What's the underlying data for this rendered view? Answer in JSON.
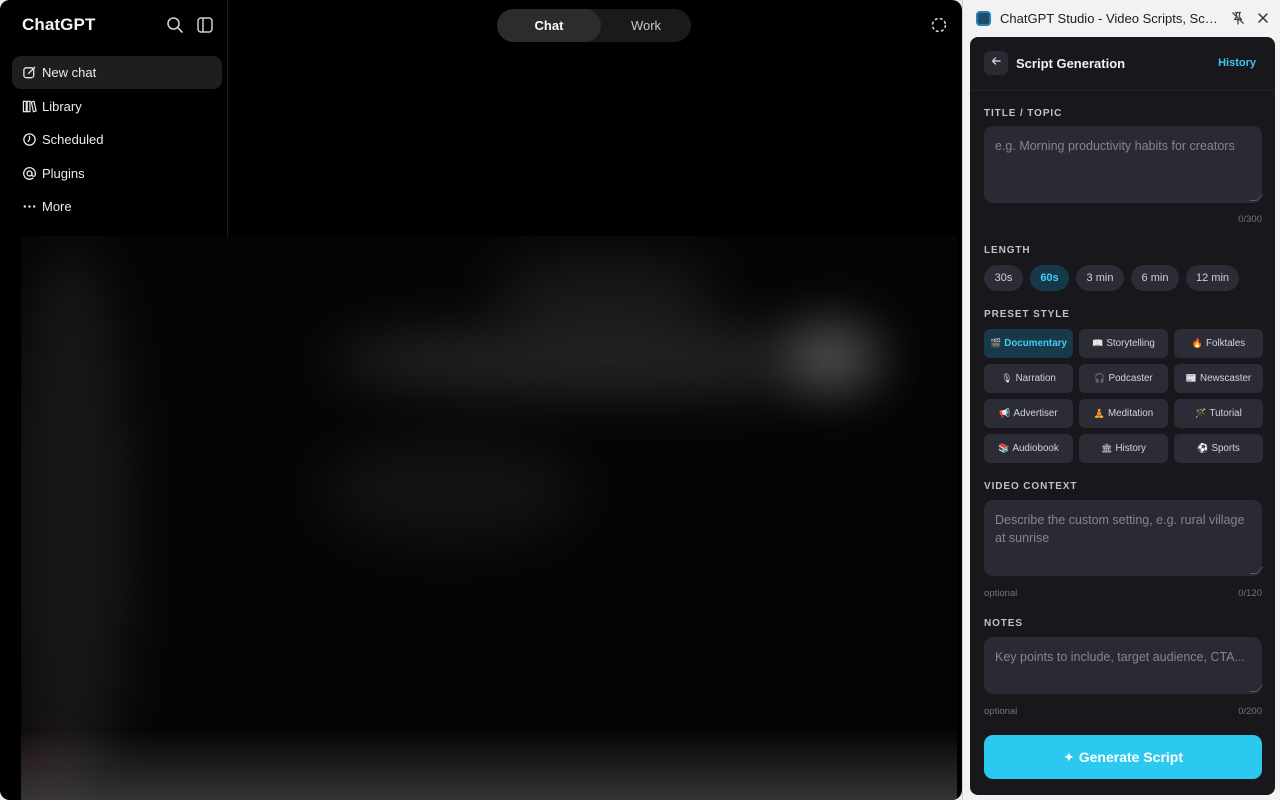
{
  "app": {
    "brand": "ChatGPT",
    "nav": [
      {
        "label": "New chat",
        "icon": "compose-icon"
      },
      {
        "label": "Library",
        "icon": "library-icon"
      },
      {
        "label": "Scheduled",
        "icon": "clock-icon"
      },
      {
        "label": "Plugins",
        "icon": "at-icon"
      },
      {
        "label": "More",
        "icon": "ellipsis-icon"
      }
    ],
    "mode_toggle": {
      "options": [
        "Chat",
        "Work"
      ],
      "selected": "Chat"
    }
  },
  "panel": {
    "window_title": "ChatGPT Studio - Video Scripts, Sce...",
    "heading": "Script Generation",
    "history_link": "History",
    "title_section": {
      "label": "TITLE / TOPIC",
      "placeholder": "e.g. Morning productivity habits for creators",
      "value": "",
      "counter": "0/300"
    },
    "length_section": {
      "label": "LENGTH",
      "options": [
        "30s",
        "60s",
        "3 min",
        "6 min",
        "12 min"
      ],
      "selected": "60s"
    },
    "preset_section": {
      "label": "PRESET STYLE",
      "selected": "Documentary",
      "styles": [
        {
          "emoji": "🎬",
          "label": "Documentary"
        },
        {
          "emoji": "📖",
          "label": "Storytelling"
        },
        {
          "emoji": "🔥",
          "label": "Folktales"
        },
        {
          "emoji": "🎙",
          "label": "Narration"
        },
        {
          "emoji": "🎧",
          "label": "Podcaster"
        },
        {
          "emoji": "📰",
          "label": "Newscaster"
        },
        {
          "emoji": "📢",
          "label": "Advertiser"
        },
        {
          "emoji": "🧘",
          "label": "Meditation"
        },
        {
          "emoji": "🪄",
          "label": "Tutorial"
        },
        {
          "emoji": "📚",
          "label": "Audiobook"
        },
        {
          "emoji": "🏛",
          "label": "History"
        },
        {
          "emoji": "⚽",
          "label": "Sports"
        }
      ]
    },
    "context_section": {
      "label": "VIDEO CONTEXT",
      "placeholder": "Describe the custom setting, e.g. rural village at sunrise",
      "value": "",
      "hint": "optional",
      "counter": "0/120"
    },
    "notes_section": {
      "label": "NOTES",
      "placeholder": "Key points to include, target audience, CTA...",
      "value": "",
      "hint": "optional",
      "counter": "0/200"
    },
    "generate_button": {
      "icon": "✦",
      "label": "Generate Script"
    },
    "accent_color": "#2bc8f0"
  }
}
